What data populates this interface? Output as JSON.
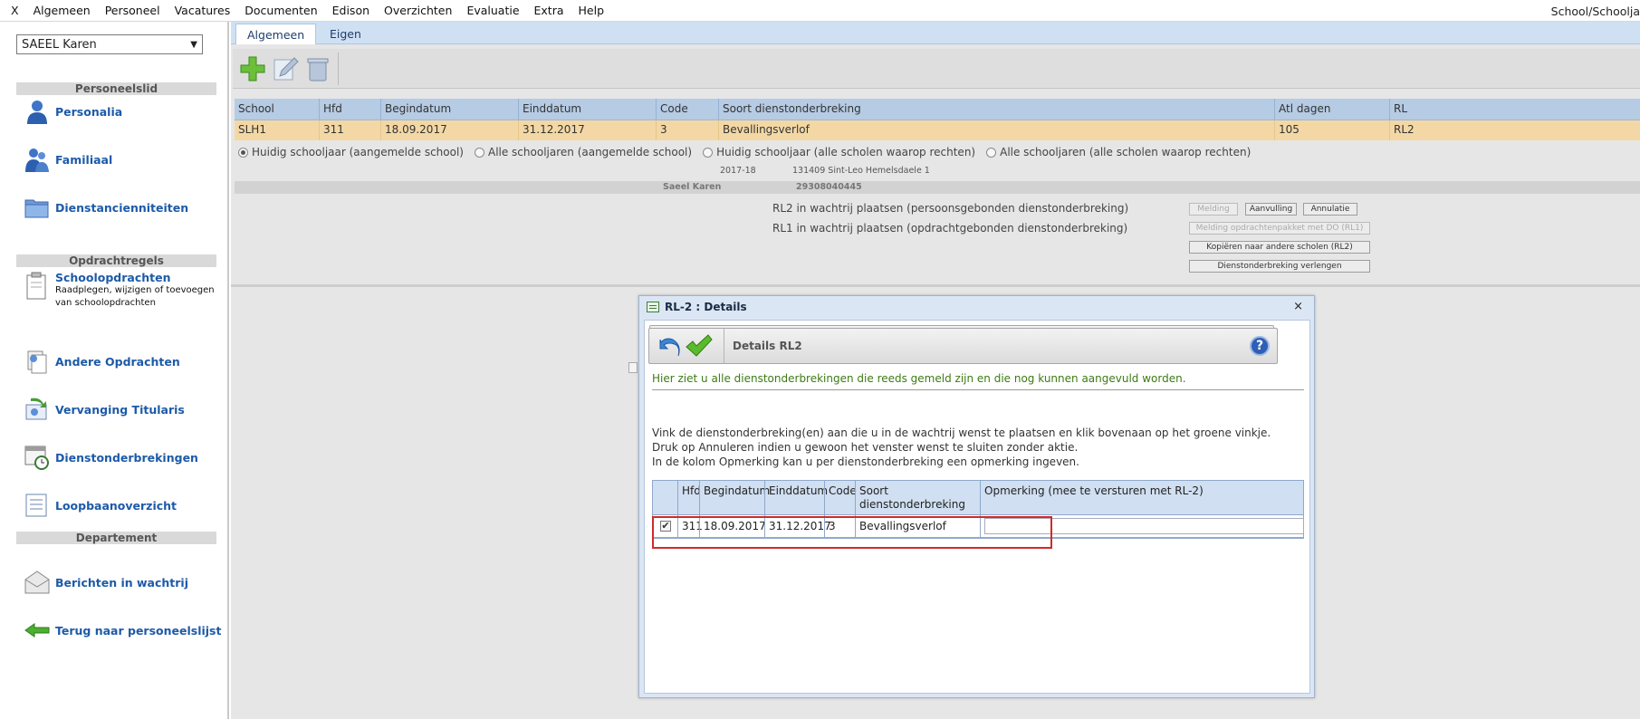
{
  "menu": {
    "close": "X",
    "items": [
      "Algemeen",
      "Personeel",
      "Vacatures",
      "Documenten",
      "Edison",
      "Overzichten",
      "Evaluatie",
      "Extra",
      "Help"
    ],
    "right_text": "School/Schoolja"
  },
  "sidebar": {
    "person_select": "SAEEL Karen",
    "section_personeelslid": "Personeelslid",
    "section_opdrachtregels": "Opdrachtregels",
    "section_departement": "Departement",
    "items": {
      "personalia": "Personalia",
      "familiaal": "Familiaal",
      "dienstancienniteiten": "Dienstancienniteiten",
      "schoolopdrachten": "Schoolopdrachten",
      "schoolopdrachten_desc": "Raadplegen, wijzigen of toevoegen van schoolopdrachten",
      "andere_opdrachten": "Andere Opdrachten",
      "vervanging_titularis": "Vervanging Titularis",
      "dienstonderbrekingen": "Dienstonderbrekingen",
      "loopbaanoverzicht": "Loopbaanoverzicht",
      "berichten_wachtrij": "Berichten in wachtrij",
      "terug_personeelslijst": "Terug naar personeelslijst"
    }
  },
  "tabs": {
    "algemeen": "Algemeen",
    "eigen": "Eigen"
  },
  "grid": {
    "headers": [
      "School",
      "Hfd",
      "Begindatum",
      "Einddatum",
      "Code",
      "Soort dienstonderbreking",
      "Atl dagen",
      "RL"
    ],
    "row": [
      "SLH1",
      "311",
      "18.09.2017",
      "31.12.2017",
      "3",
      "Bevallingsverlof",
      "105",
      "RL2"
    ]
  },
  "filters": {
    "opt1": "Huidig schooljaar (aangemelde school)",
    "opt2": "Alle schooljaren (aangemelde school)",
    "opt3": "Huidig schooljaar (alle scholen waarop rechten)",
    "opt4": "Alle schooljaren (alle scholen waarop rechten)"
  },
  "school_info": {
    "year": "2017-18",
    "school": "131409 Sint-Leo Hemelsdaele 1"
  },
  "person_strip": {
    "name": "Saeel Karen",
    "number": "29308040445"
  },
  "actions": {
    "rl2_text": "RL2 in wachtrij plaatsen (persoonsgebonden dienstonderbreking)",
    "rl1_text": "RL1 in wachtrij plaatsen (opdrachtgebonden dienstonderbreking)",
    "melding": "Melding",
    "aanvulling": "Aanvulling",
    "annulatie": "Annulatie",
    "melding_pakket": "Melding opdrachtenpakket met DO (RL1)",
    "kopieren": "Kopiëren naar andere scholen (RL2)",
    "verlengen": "Dienstonderbreking verlengen"
  },
  "dialog": {
    "title": "RL-2 : Details",
    "close": "×",
    "header": "Details RL2",
    "help": "?",
    "green_text": "Hier ziet u alle dienstonderbrekingen die reeds gemeld zijn en die nog kunnen aangevuld worden.",
    "instr1": "Vink de dienstonderbreking(en) aan die u in de wachtrij wenst te plaatsen en klik bovenaan op het groene vinkje.",
    "instr2": "Druk op Annuleren indien u gewoon het venster wenst te sluiten zonder aktie.",
    "instr3": "In de kolom Opmerking kan u per dienstonderbreking een opmerking ingeven.",
    "table": {
      "headers": [
        "Hfd",
        "Begindatum",
        "Einddatum",
        "Code",
        "Soort dienstonderbreking",
        "Opmerking (mee te versturen met RL-2)"
      ],
      "row": {
        "checked": "✔",
        "hfd": "311",
        "begin": "18.09.2017",
        "eind": "31.12.2017",
        "code": "3",
        "soort": "Bevallingsverlof",
        "opmerking": ""
      }
    }
  },
  "colors": {
    "accent_blue": "#1d5aa8",
    "selected_row": "#f3d8a5",
    "highlight_red": "#d12a2a",
    "green_text": "#3d7b13"
  }
}
